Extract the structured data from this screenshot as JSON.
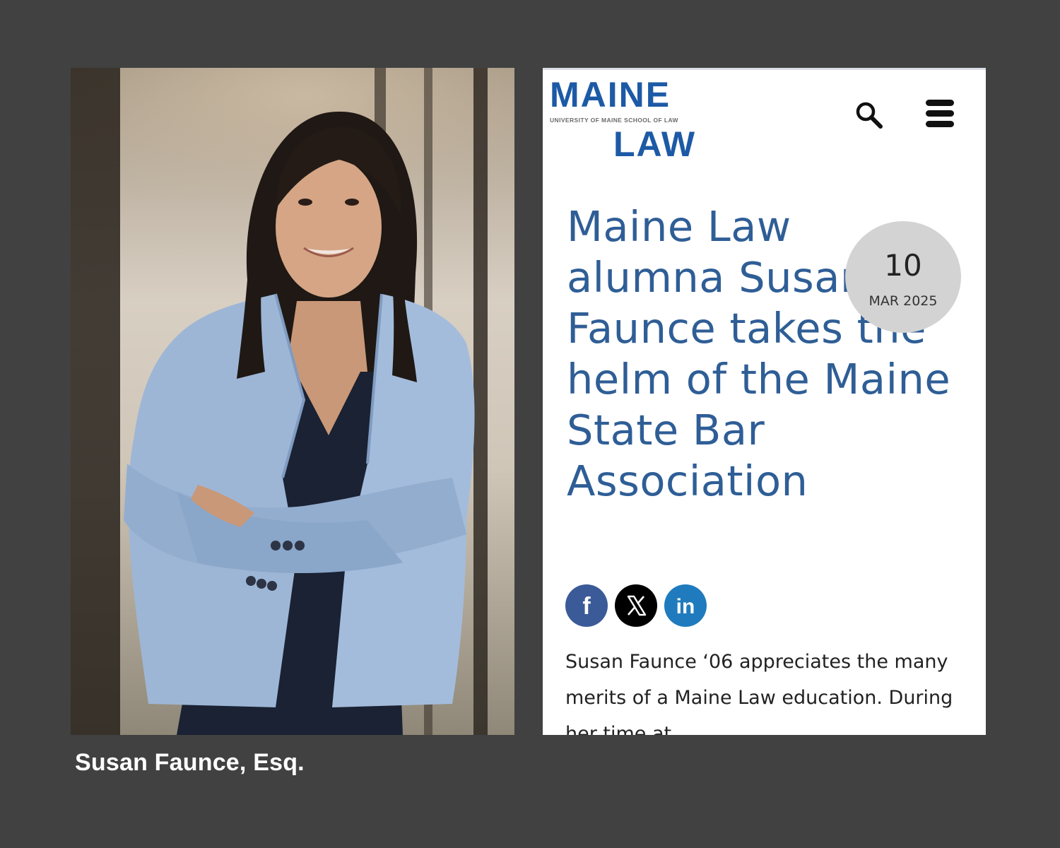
{
  "caption": "Susan Faunce, Esq.",
  "photo": {
    "subject": "portrait-photo"
  },
  "site": {
    "logo_top": "MAINE",
    "logo_sub": "UNIVERSITY OF MAINE SCHOOL OF LAW",
    "logo_bottom": "LAW",
    "brand_color": "#1d5aa6",
    "search_icon": "search-icon",
    "menu_icon": "hamburger-menu-icon"
  },
  "article": {
    "headline": "Maine Law alumna Susan Faunce takes the helm of the Maine State Bar Association",
    "headline_color": "#2f5e96",
    "date_day": "10",
    "date_month_year": "MAR 2025",
    "share": {
      "facebook_icon": "facebook-icon",
      "x_icon": "x-icon",
      "linkedin_icon": "linkedin-icon",
      "linkedin_label": "in",
      "facebook_label": "f"
    },
    "body": "Susan Faunce ‘06 appreciates the many merits of a Maine Law education. During her time at"
  },
  "colors": {
    "page_background": "#414141",
    "facebook": "#3b5a98",
    "x": "#000000",
    "linkedin": "#1f7bbd",
    "date_badge": "#d3d3d3"
  }
}
